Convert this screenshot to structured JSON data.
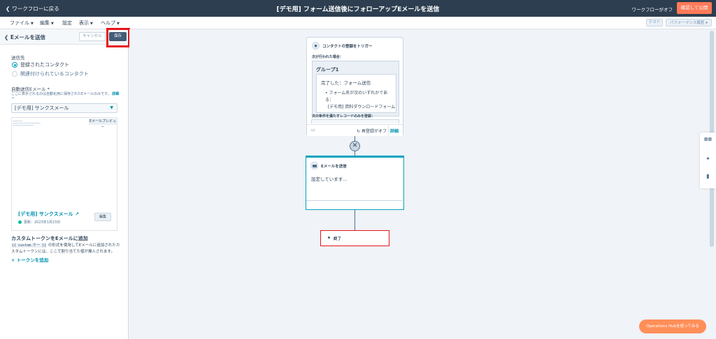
{
  "topbar": {
    "back_label": "ワークフローに戻る",
    "title": "[デモ用] フォーム送信後にフォローアップEメールを送信",
    "workflow_status": "ワークフローがオフ",
    "publish_label": "確認して公開"
  },
  "menubar": {
    "file": "ファイル",
    "edit": "編集",
    "settings": "設定",
    "view": "表示",
    "help": "ヘルプ",
    "test_label": "テスト",
    "performance_label": "パフォーマンス履歴"
  },
  "panel": {
    "title": "Eメールを送信",
    "cancel_label": "キャンセル",
    "save_label": "保存",
    "send_to_label": "送信先",
    "radio_registered": "登録されたコンタクト",
    "radio_associated": "関連付けられているコンタクト",
    "auto_email_label": "自動送信Eメール *",
    "auto_email_help": "ここに表示されるのは自動化用に保存されたEメールのみです。",
    "auto_email_help_link": "詳細",
    "selected_email": "[デモ用] サンクスメール",
    "preview_badge": "Eメールプレビュー",
    "preview_name": "[デモ用] サンクスメール",
    "preview_updated": "更新：2023年1月23日",
    "edit_label": "編集",
    "token_title": "カスタムトークンをEメールに追加",
    "token_code": "{{ custom.ケー }}",
    "token_desc_rest": "の形式を使用してEメールに追加されたカスタムトークンには、ここで割り当てた値が挿入されます。",
    "token_add": "トークンを追加"
  },
  "canvas": {
    "trigger": {
      "header": "コンタクトの登録をトリガー",
      "when_label": "次が行われた場合：",
      "group_title": "グループ1",
      "completed_label": "完了した：フォーム送信",
      "bullet_line1": "フォーム名が次のいずれかである：",
      "bullet_line2": "[デモ用] 資料ダウンロードフォーム",
      "reenroll_filter_label": "次の条件を満たすレコードのみを登録：",
      "reenroll_label": "再登録がオフ",
      "details_label": "詳細"
    },
    "send_email": {
      "header": "Eメールを送信",
      "status_text": "設定しています..."
    },
    "end": {
      "label": "終了"
    }
  },
  "ops_hub_label": "Operations Hubを使ってみる",
  "colors": {
    "topbar_bg": "#2d3e50",
    "accent_orange": "#ff7a59",
    "accent_teal": "#00a4bd",
    "highlight_red": "#e8141c"
  }
}
